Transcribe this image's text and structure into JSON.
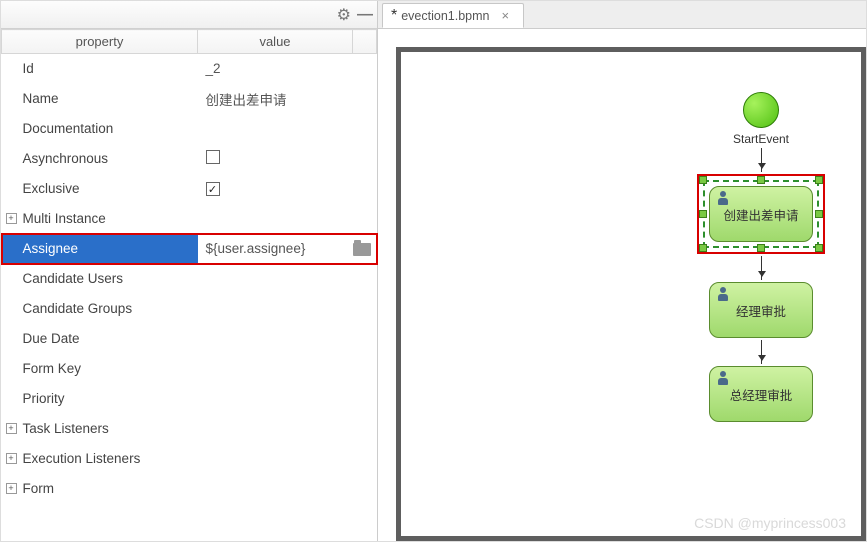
{
  "panel": {
    "headers": {
      "property": "property",
      "value": "value"
    },
    "rows": {
      "id": {
        "label": "Id",
        "value": "_2"
      },
      "name": {
        "label": "Name",
        "value": "创建出差申请"
      },
      "doc": {
        "label": "Documentation",
        "value": ""
      },
      "async": {
        "label": "Asynchronous",
        "checked": false
      },
      "exclusive": {
        "label": "Exclusive",
        "checked": true
      },
      "multi": {
        "label": "Multi Instance",
        "expandable": true
      },
      "assignee": {
        "label": "Assignee",
        "value": "${user.assignee}"
      },
      "candUsers": {
        "label": "Candidate Users",
        "value": ""
      },
      "candGroups": {
        "label": "Candidate Groups",
        "value": ""
      },
      "dueDate": {
        "label": "Due Date",
        "value": ""
      },
      "formKey": {
        "label": "Form Key",
        "value": ""
      },
      "priority": {
        "label": "Priority",
        "value": ""
      },
      "taskL": {
        "label": "Task Listeners",
        "expandable": true
      },
      "execL": {
        "label": "Execution Listeners",
        "expandable": true
      },
      "form": {
        "label": "Form",
        "expandable": true
      }
    },
    "expander_glyph": "+",
    "check_glyph": "✓"
  },
  "editor": {
    "tab_label": "evection1.bpmn",
    "tab_dirty": "*",
    "tab_close": "×"
  },
  "diagram": {
    "start_label": "StartEvent",
    "task_create": "创建出差申请",
    "task_manager": "经理审批",
    "task_general": "总经理审批"
  },
  "watermark": "CSDN @myprincess003"
}
